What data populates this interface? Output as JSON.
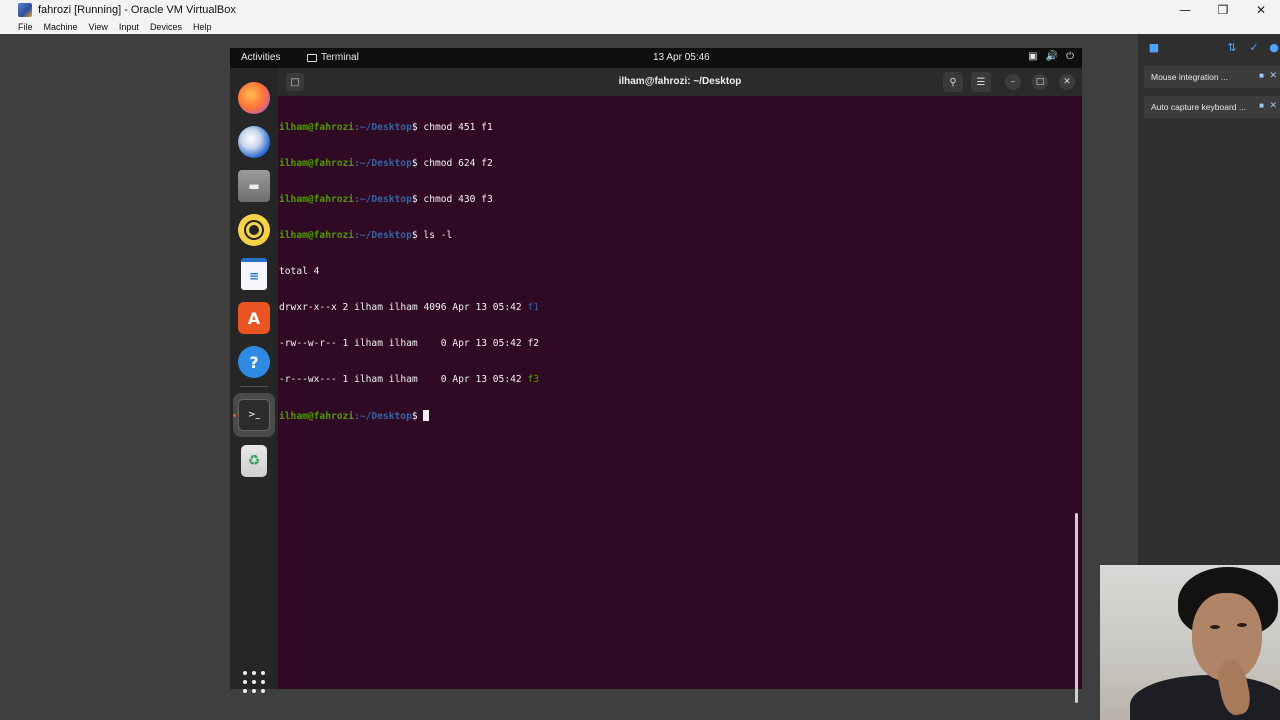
{
  "host": {
    "title": "fahrozi [Running] - Oracle VM VirtualBox",
    "menu": [
      "File",
      "Machine",
      "View",
      "Input",
      "Devices",
      "Help"
    ]
  },
  "ubuntu": {
    "activities": "Activities",
    "app_indicator": "Terminal",
    "clock": "13 Apr  05:46"
  },
  "dock": {
    "items": [
      "firefox-icon",
      "thunderbird-icon",
      "files-icon",
      "rhythmbox-icon",
      "libreoffice-writer-icon",
      "ubuntu-software-icon",
      "help-icon",
      "terminal-icon",
      "trash-icon"
    ]
  },
  "terminal": {
    "title": "ilham@fahrozi: ~/Desktop",
    "prompt_user": "ilham@fahrozi",
    "prompt_path": ":~/Desktop",
    "prompt_symbol": "$",
    "commands": [
      "chmod 451 f1",
      "chmod 624 f2",
      "chmod 430 f3",
      "ls -l"
    ],
    "output": {
      "total": "total 4",
      "rows": [
        {
          "perms": "drwxr-x--x",
          "links": "2",
          "owner": "ilham",
          "group": "ilham",
          "size": "4096",
          "date": "Apr 13 05:42",
          "name": "f1"
        },
        {
          "perms": "-rw--w-r--",
          "links": "1",
          "owner": "ilham",
          "group": "ilham",
          "size": "0",
          "date": "Apr 13 05:42",
          "name": "f2"
        },
        {
          "perms": "-r---wx---",
          "links": "1",
          "owner": "ilham",
          "group": "ilham",
          "size": "0",
          "date": "Apr 13 05:42",
          "name": "f3"
        }
      ]
    }
  },
  "vbox_panel": {
    "notifications": [
      "Mouse integration ...",
      "Auto capture keyboard ..."
    ]
  },
  "colors": {
    "terminal_bg": "#300a24",
    "prompt_user": "#4e9a06",
    "prompt_path": "#3465a4",
    "ubuntu_orange": "#e95420"
  }
}
